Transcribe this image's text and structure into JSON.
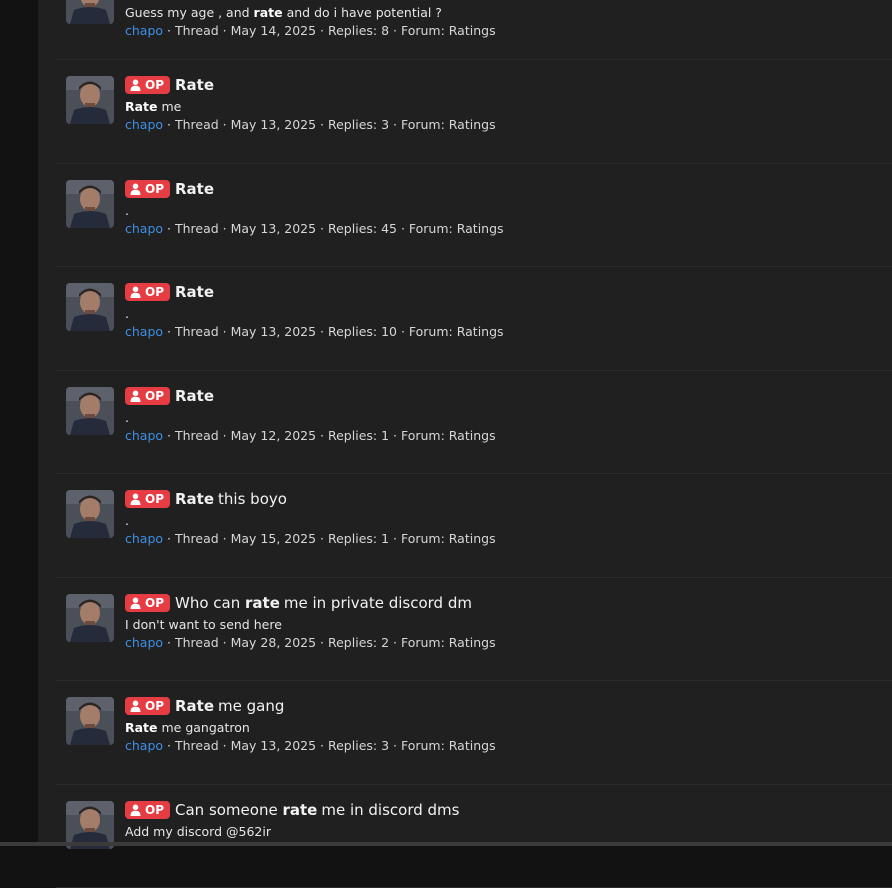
{
  "avatar_icon": "user-portrait-photo",
  "badge_icon": "user-icon",
  "results": [
    {
      "op_label": "",
      "title_bold": "",
      "title_rest": "",
      "snippet_pre": "Guess my age , and ",
      "snippet_bold": "rate",
      "snippet_post": " and do i have potential ?",
      "author": "chapo",
      "meta": " · Thread · May 14, 2025 · Replies: 8 · Forum: Ratings"
    },
    {
      "op_label": "OP",
      "title_pre": "",
      "title_bold": "Rate",
      "title_rest": "",
      "snippet_pre": "",
      "snippet_bold": "Rate",
      "snippet_post": " me",
      "author": "chapo",
      "meta": " · Thread · May 13, 2025 · Replies: 3 · Forum: Ratings"
    },
    {
      "op_label": "OP",
      "title_pre": "",
      "title_bold": "Rate",
      "title_rest": "",
      "snippet_pre": ".",
      "snippet_bold": "",
      "snippet_post": "",
      "author": "chapo",
      "meta": " · Thread · May 13, 2025 · Replies: 45 · Forum: Ratings"
    },
    {
      "op_label": "OP",
      "title_pre": "",
      "title_bold": "Rate",
      "title_rest": "",
      "snippet_pre": ".",
      "snippet_bold": "",
      "snippet_post": "",
      "author": "chapo",
      "meta": " · Thread · May 13, 2025 · Replies: 10 · Forum: Ratings"
    },
    {
      "op_label": "OP",
      "title_pre": "",
      "title_bold": "Rate",
      "title_rest": "",
      "snippet_pre": ".",
      "snippet_bold": "",
      "snippet_post": "",
      "author": "chapo",
      "meta": " · Thread · May 12, 2025 · Replies: 1 · Forum: Ratings"
    },
    {
      "op_label": "OP",
      "title_pre": "",
      "title_bold": "Rate",
      "title_rest": "this boyo",
      "snippet_pre": ".",
      "snippet_bold": "",
      "snippet_post": "",
      "author": "chapo",
      "meta": " · Thread · May 15, 2025 · Replies: 1 · Forum: Ratings"
    },
    {
      "op_label": "OP",
      "title_pre": "Who can ",
      "title_bold": "rate",
      "title_rest": "me in private discord dm",
      "snippet_pre": "I don't want to send here",
      "snippet_bold": "",
      "snippet_post": "",
      "author": "chapo",
      "meta": " · Thread · May 28, 2025 · Replies: 2 · Forum: Ratings"
    },
    {
      "op_label": "OP",
      "title_pre": "",
      "title_bold": "Rate",
      "title_rest": "me gang",
      "snippet_pre": "",
      "snippet_bold": "Rate",
      "snippet_post": " me gangatron",
      "author": "chapo",
      "meta": " · Thread · May 13, 2025 · Replies: 3 · Forum: Ratings"
    },
    {
      "op_label": "OP",
      "title_pre": "Can someone ",
      "title_bold": "rate",
      "title_rest": "me in discord dms",
      "snippet_pre": "Add my discord @562ir",
      "snippet_bold": "",
      "snippet_post": "",
      "author": "",
      "meta": ""
    }
  ]
}
